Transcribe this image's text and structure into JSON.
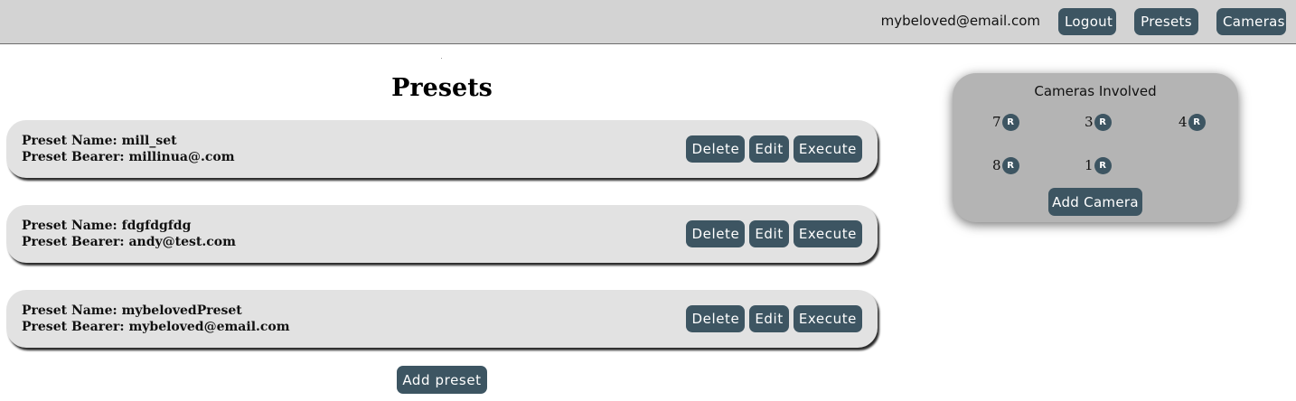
{
  "header": {
    "user_email": "mybeloved@email.com",
    "logout_label": "Logout",
    "presets_label": "Presets",
    "cameras_label": "Cameras"
  },
  "main": {
    "title": "Presets",
    "presets": [
      {
        "name_line": "Preset Name: mill_set",
        "bearer_line": "Preset Bearer: millinua@.com",
        "delete_label": "Delete",
        "edit_label": "Edit",
        "execute_label": "Execute"
      },
      {
        "name_line": "Preset Name: fdgfdgfdg",
        "bearer_line": "Preset Bearer: andy@test.com",
        "delete_label": "Delete",
        "edit_label": "Edit",
        "execute_label": "Execute"
      },
      {
        "name_line": "Preset Name: mybelovedPreset",
        "bearer_line": "Preset Bearer: mybeloved@email.com",
        "delete_label": "Delete",
        "edit_label": "Edit",
        "execute_label": "Execute"
      }
    ],
    "add_preset_label": "Add preset"
  },
  "cameras_panel": {
    "title": "Cameras Involved",
    "cameras": [
      {
        "number": "7",
        "remove_label": "R"
      },
      {
        "number": "3",
        "remove_label": "R"
      },
      {
        "number": "4",
        "remove_label": "R"
      },
      {
        "number": "8",
        "remove_label": "R"
      },
      {
        "number": "1",
        "remove_label": "R"
      }
    ],
    "add_camera_label": "Add Camera"
  },
  "colors": {
    "button": "#3d5562",
    "topbar": "#d3d3d3",
    "card": "#e2e2e2",
    "panel": "#b4b4b4"
  }
}
